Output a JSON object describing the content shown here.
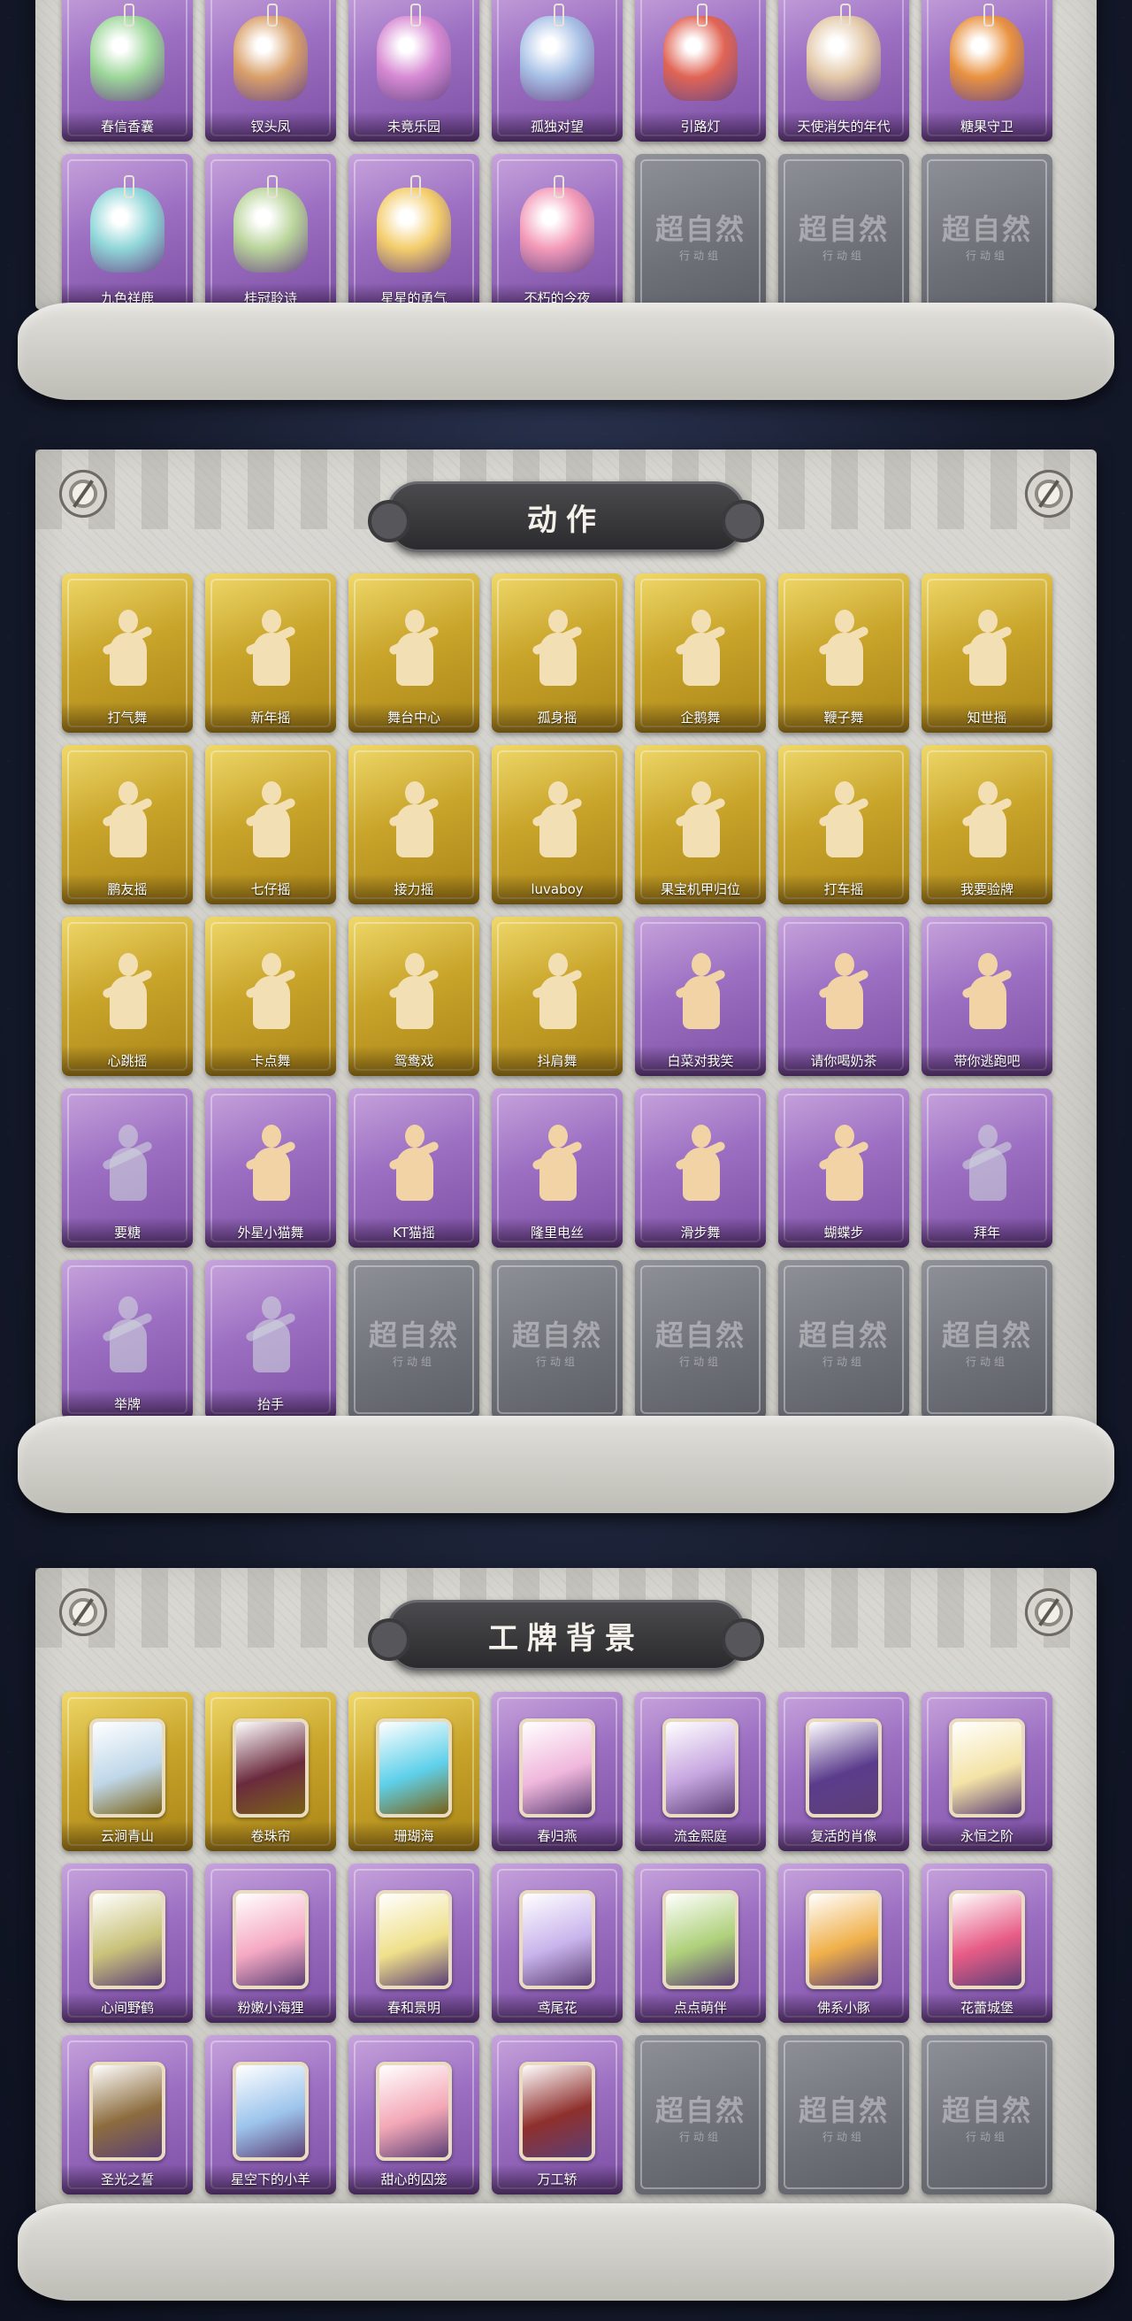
{
  "sections": {
    "pendants": {
      "rows": [
        [
          {
            "label": "春信香囊",
            "type": "purple",
            "art": "pendant",
            "color": "#9dd79a"
          },
          {
            "label": "钗头凤",
            "type": "purple",
            "art": "pendant",
            "color": "#d9a06a"
          },
          {
            "label": "未竟乐园",
            "type": "purple",
            "art": "pendant",
            "color": "#d78ad3"
          },
          {
            "label": "孤独对望",
            "type": "purple",
            "art": "pendant",
            "color": "#a8c1e6"
          },
          {
            "label": "引路灯",
            "type": "purple",
            "art": "pendant",
            "color": "#e06454"
          },
          {
            "label": "天使消失的年代",
            "type": "purple",
            "art": "pendant",
            "color": "#e3c8a8"
          },
          {
            "label": "糖果守卫",
            "type": "purple",
            "art": "pendant",
            "color": "#e99240"
          }
        ],
        [
          {
            "label": "九色祥鹿",
            "type": "purple",
            "art": "pendant",
            "color": "#8fd6d8"
          },
          {
            "label": "桂冠聆诗",
            "type": "purple",
            "art": "pendant",
            "color": "#b9d49a"
          },
          {
            "label": "星星的勇气",
            "type": "purple",
            "art": "pendant",
            "color": "#f3cd6a"
          },
          {
            "label": "不朽的今夜",
            "type": "purple",
            "art": "pendant",
            "color": "#f39ab8"
          },
          {
            "label": "",
            "type": "empty"
          },
          {
            "label": "",
            "type": "empty"
          },
          {
            "label": "",
            "type": "empty"
          }
        ]
      ]
    },
    "actions": {
      "title": "动作",
      "rows": [
        [
          {
            "label": "打气舞",
            "type": "gold",
            "art": "silhouette"
          },
          {
            "label": "新年摇",
            "type": "gold",
            "art": "silhouette"
          },
          {
            "label": "舞台中心",
            "type": "gold",
            "art": "silhouette"
          },
          {
            "label": "孤身摇",
            "type": "gold",
            "art": "silhouette"
          },
          {
            "label": "企鹅舞",
            "type": "gold",
            "art": "silhouette"
          },
          {
            "label": "鞭子舞",
            "type": "gold",
            "art": "silhouette"
          },
          {
            "label": "知世摇",
            "type": "gold",
            "art": "silhouette"
          }
        ],
        [
          {
            "label": "鹏友摇",
            "type": "gold",
            "art": "silhouette"
          },
          {
            "label": "七仔摇",
            "type": "gold",
            "art": "silhouette"
          },
          {
            "label": "接力摇",
            "type": "gold",
            "art": "silhouette"
          },
          {
            "label": "luvaboy",
            "type": "gold",
            "art": "silhouette"
          },
          {
            "label": "果宝机甲归位",
            "type": "gold",
            "art": "silhouette"
          },
          {
            "label": "打车摇",
            "type": "gold",
            "art": "silhouette"
          },
          {
            "label": "我要验牌",
            "type": "gold",
            "art": "silhouette"
          }
        ],
        [
          {
            "label": "心跳摇",
            "type": "gold",
            "art": "silhouette"
          },
          {
            "label": "卡点舞",
            "type": "gold",
            "art": "silhouette"
          },
          {
            "label": "鸳鸯戏",
            "type": "gold",
            "art": "silhouette"
          },
          {
            "label": "抖肩舞",
            "type": "gold",
            "art": "silhouette"
          },
          {
            "label": "白菜对我笑",
            "type": "purple",
            "art": "silhouette"
          },
          {
            "label": "请你喝奶茶",
            "type": "purple",
            "art": "silhouette"
          },
          {
            "label": "带你逃跑吧",
            "type": "purple",
            "art": "silhouette"
          }
        ],
        [
          {
            "label": "要糖",
            "type": "purple",
            "art": "silhouette-faded"
          },
          {
            "label": "外星小猫舞",
            "type": "purple",
            "art": "silhouette"
          },
          {
            "label": "KT猫摇",
            "type": "purple",
            "art": "silhouette"
          },
          {
            "label": "隆里电丝",
            "type": "purple",
            "art": "silhouette"
          },
          {
            "label": "滑步舞",
            "type": "purple",
            "art": "silhouette"
          },
          {
            "label": "蝴蝶步",
            "type": "purple",
            "art": "silhouette"
          },
          {
            "label": "拜年",
            "type": "purple",
            "art": "silhouette-faded"
          }
        ],
        [
          {
            "label": "举牌",
            "type": "purple",
            "art": "silhouette-faded"
          },
          {
            "label": "抬手",
            "type": "purple",
            "art": "silhouette-faded"
          },
          {
            "label": "",
            "type": "empty"
          },
          {
            "label": "",
            "type": "empty"
          },
          {
            "label": "",
            "type": "empty"
          },
          {
            "label": "",
            "type": "empty"
          },
          {
            "label": "",
            "type": "empty"
          }
        ]
      ]
    },
    "badges": {
      "title": "工牌背景",
      "rows": [
        [
          {
            "label": "云涧青山",
            "type": "gold",
            "art": "card-bg",
            "color": "#bfd7e9"
          },
          {
            "label": "卷珠帘",
            "type": "gold",
            "art": "card-bg",
            "color": "#6a2a3e"
          },
          {
            "label": "珊瑚海",
            "type": "gold",
            "art": "card-bg",
            "color": "#5ed0ea"
          },
          {
            "label": "春归燕",
            "type": "purple",
            "art": "card-bg",
            "color": "#f0b7dc"
          },
          {
            "label": "流金熙庭",
            "type": "purple",
            "art": "card-bg",
            "color": "#c7a6e0"
          },
          {
            "label": "复活的肖像",
            "type": "purple",
            "art": "card-bg",
            "color": "#5a3b8c"
          },
          {
            "label": "永恒之阶",
            "type": "purple",
            "art": "card-bg",
            "color": "#f4e3a6"
          }
        ],
        [
          {
            "label": "心间野鹤",
            "type": "purple",
            "art": "card-bg",
            "color": "#c9c27a"
          },
          {
            "label": "粉嫩小海狸",
            "type": "purple",
            "art": "card-bg",
            "color": "#f5a9c3"
          },
          {
            "label": "春和景明",
            "type": "purple",
            "art": "card-bg",
            "color": "#efe08a"
          },
          {
            "label": "鸢尾花",
            "type": "purple",
            "art": "card-bg",
            "color": "#c9b4ec"
          },
          {
            "label": "点点萌伴",
            "type": "purple",
            "art": "card-bg",
            "color": "#aed07a"
          },
          {
            "label": "佛系小豚",
            "type": "purple",
            "art": "card-bg",
            "color": "#f0b04a"
          },
          {
            "label": "花蕾城堡",
            "type": "purple",
            "art": "card-bg",
            "color": "#e75c86"
          }
        ],
        [
          {
            "label": "圣光之誓",
            "type": "purple",
            "art": "card-bg",
            "color": "#8c6c3e"
          },
          {
            "label": "星空下的小羊",
            "type": "purple",
            "art": "card-bg",
            "color": "#9cc4ec"
          },
          {
            "label": "甜心的囚笼",
            "type": "purple",
            "art": "card-bg",
            "color": "#f3a7b6"
          },
          {
            "label": "万工轿",
            "type": "purple",
            "art": "card-bg",
            "color": "#8e2f2c"
          },
          {
            "label": "",
            "type": "empty"
          },
          {
            "label": "",
            "type": "empty"
          },
          {
            "label": "",
            "type": "empty"
          }
        ]
      ]
    }
  },
  "watermark": {
    "main": "超自然",
    "sub": "行动组"
  },
  "icons": {
    "compass": "compass-icon",
    "silhouette": "dancer-silhouette-icon",
    "pendant": "pendant-charm-icon",
    "card": "badge-background-icon"
  }
}
